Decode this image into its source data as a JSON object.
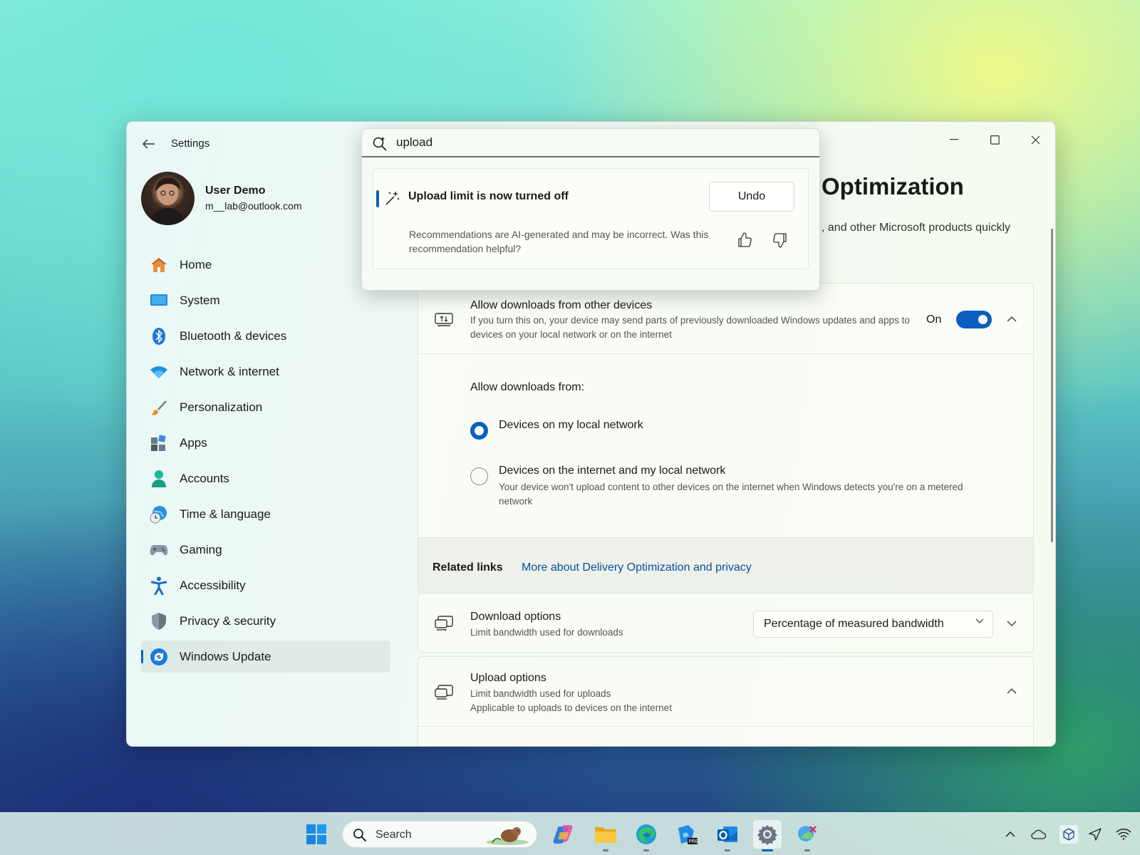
{
  "window": {
    "app_title": "Settings",
    "user_name": "User Demo",
    "user_email": "m__lab@outlook.com"
  },
  "sidebar": {
    "items": [
      {
        "label": "Home",
        "icon": "home-icon"
      },
      {
        "label": "System",
        "icon": "system-icon"
      },
      {
        "label": "Bluetooth & devices",
        "icon": "bluetooth-icon"
      },
      {
        "label": "Network & internet",
        "icon": "wifi-icon"
      },
      {
        "label": "Personalization",
        "icon": "brush-icon"
      },
      {
        "label": "Apps",
        "icon": "apps-icon"
      },
      {
        "label": "Accounts",
        "icon": "accounts-icon"
      },
      {
        "label": "Time & language",
        "icon": "globe-clock-icon"
      },
      {
        "label": "Gaming",
        "icon": "gamepad-icon"
      },
      {
        "label": "Accessibility",
        "icon": "accessibility-icon"
      },
      {
        "label": "Privacy & security",
        "icon": "shield-icon"
      },
      {
        "label": "Windows Update",
        "icon": "update-icon"
      }
    ],
    "active": "Windows Update"
  },
  "search": {
    "value": "upload",
    "recommendation_title": "Upload limit is now turned off",
    "undo_label": "Undo",
    "recommendation_note": "Recommendations are AI-generated and may be incorrect. Was this recommendation helpful?"
  },
  "main": {
    "page_title": "Optimization",
    "page_description": ", and other Microsoft products quickly",
    "allow_downloads": {
      "title": "Allow downloads from other devices",
      "description": "If you turn this on, your device may send parts of previously downloaded Windows updates and apps to devices on your local network or on the internet",
      "toggle_label": "On",
      "toggle_on": true,
      "from_label": "Allow downloads from:",
      "options": [
        {
          "label": "Devices on my local network",
          "selected": true,
          "description": ""
        },
        {
          "label": "Devices on the internet and my local network",
          "selected": false,
          "description": "Your device won't upload content to other devices on the internet when Windows detects you're on a metered network"
        }
      ]
    },
    "related": {
      "label": "Related links",
      "link": "More about Delivery Optimization and privacy"
    },
    "download_options": {
      "title": "Download options",
      "description": "Limit bandwidth used for downloads",
      "dropdown_value": "Percentage of measured bandwidth"
    },
    "upload_options": {
      "title": "Upload options",
      "description_1": "Limit bandwidth used for uploads",
      "description_2": "Applicable to uploads to devices on the internet"
    }
  },
  "taskbar": {
    "search_placeholder": "Search",
    "apps": [
      "start-icon",
      "copilot-icon",
      "file-explorer-icon",
      "edge-icon",
      "photos-preview-icon",
      "outlook-icon",
      "settings-icon",
      "snipping-icon"
    ],
    "active_app": "settings-icon"
  },
  "colors": {
    "accent": "#0a5fc0",
    "link": "#0a4fa0"
  }
}
